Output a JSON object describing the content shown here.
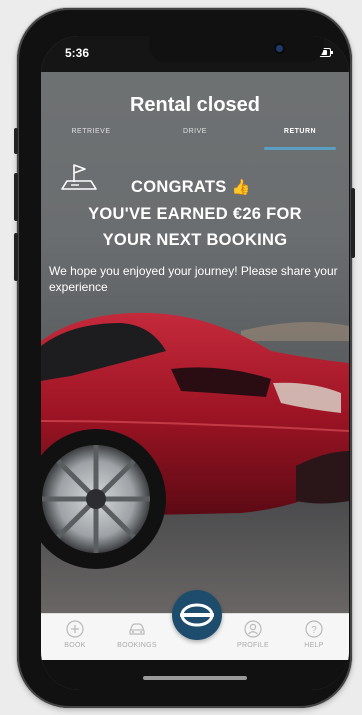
{
  "status_bar": {
    "time": "5:36",
    "signal": "....",
    "icons": [
      "wifi-icon",
      "battery-icon"
    ]
  },
  "header": {
    "title": "Rental closed"
  },
  "tabs": [
    {
      "label": "RETRIEVE",
      "active": false
    },
    {
      "label": "DRIVE",
      "active": false
    },
    {
      "label": "RETURN",
      "active": true
    }
  ],
  "congrats": {
    "line1": "CONGRATS",
    "emoji": "👍",
    "line2": "YOU'VE EARNED €26 FOR",
    "line3": "YOUR NEXT BOOKING"
  },
  "message": "We hope you enjoyed your journey! Please share your experience",
  "tabbar": {
    "items": [
      {
        "label": "BOOK",
        "icon": "plus-circle-icon"
      },
      {
        "label": "BOOKINGS",
        "icon": "car-icon"
      },
      {
        "label": "",
        "icon": "brand-logo-icon"
      },
      {
        "label": "PROFILE",
        "icon": "profile-icon"
      },
      {
        "label": "HELP",
        "icon": "help-icon"
      }
    ]
  },
  "colors": {
    "accent": "#5b9ec3",
    "center_button": "#1e4c6d",
    "car": "#b0182a"
  }
}
